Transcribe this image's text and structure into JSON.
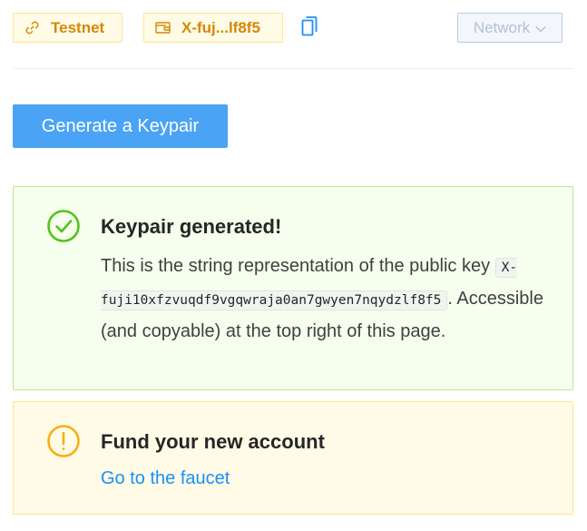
{
  "header": {
    "network_tag": "Testnet",
    "address_tag": "X-fuj...lf8f5",
    "network_button": "Network",
    "icons": {
      "network_tag": "link-icon",
      "address_tag": "wallet-icon",
      "copy": "copy-icon",
      "network_button": "chevron-down-icon"
    }
  },
  "actions": {
    "generate_button": "Generate a Keypair"
  },
  "success_alert": {
    "title": "Keypair generated!",
    "text_before": "This is the string representation of the public key ",
    "public_key": "X-fuji10xfzvuqdf9vgqwraja0an7gwyen7nqydzlf8f5",
    "text_after": ". Accessible (and copyable) at the top right of this page.",
    "icon": "check-circle-icon"
  },
  "warning_alert": {
    "title": "Fund your new account",
    "link": "Go to the faucet",
    "icon": "exclamation-circle-icon"
  },
  "colors": {
    "primary": "#4aa3f5",
    "link": "#1890ff",
    "success": "#52c41a",
    "warning": "#faad14",
    "tag_text": "#d48806"
  }
}
